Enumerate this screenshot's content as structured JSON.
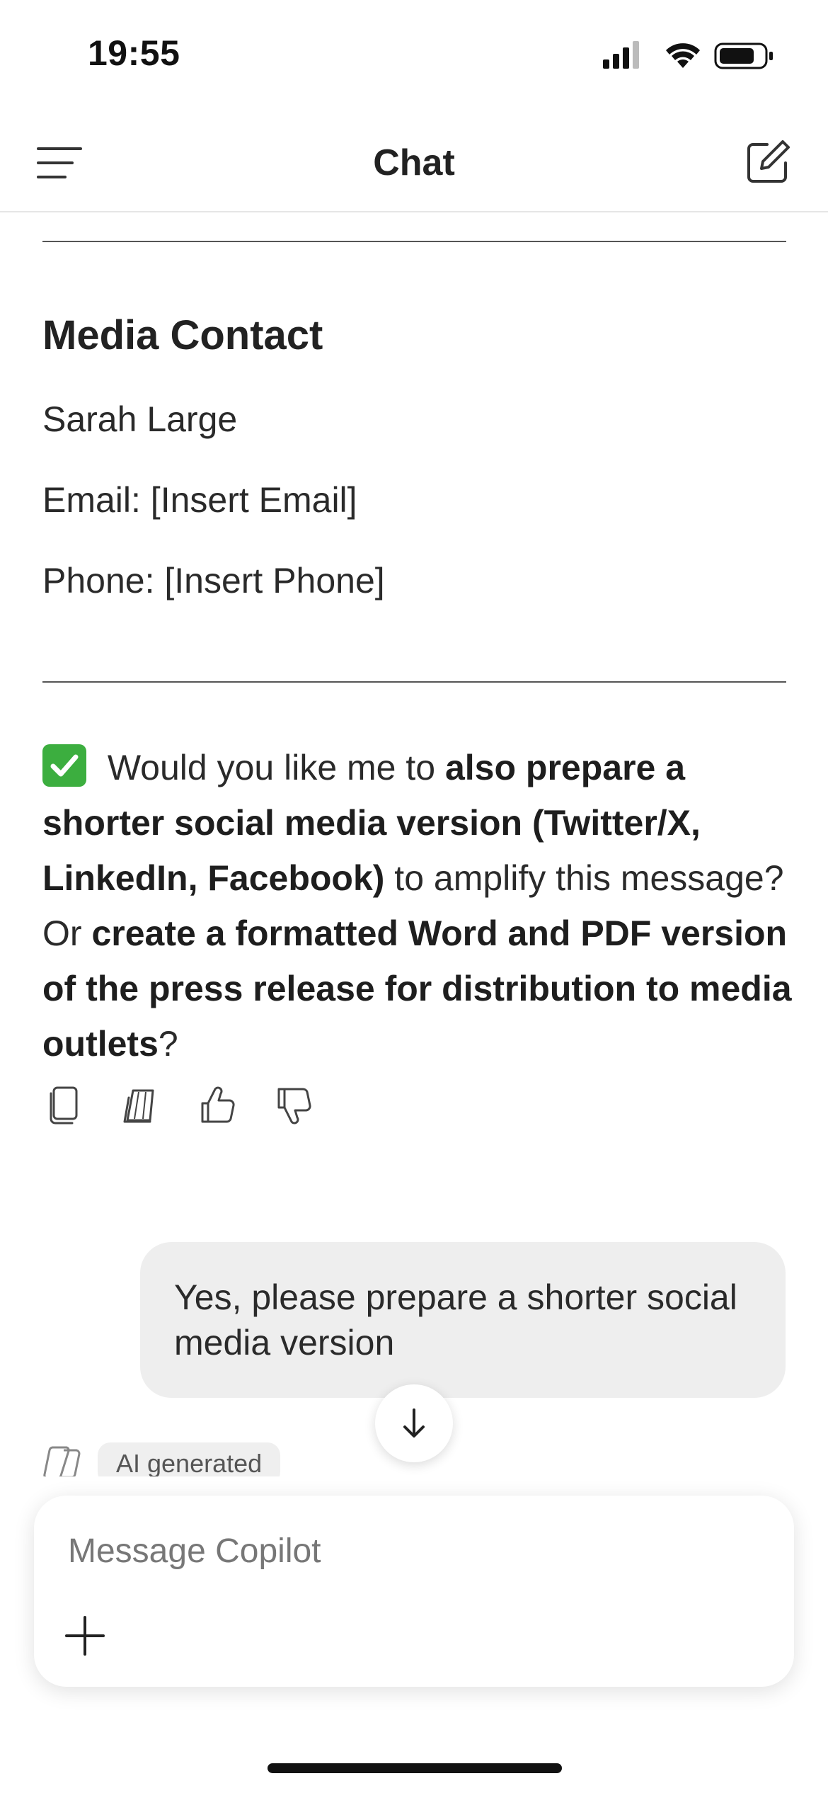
{
  "status_bar": {
    "time": "19:55",
    "icons": [
      "cellular-signal-icon",
      "wifi-icon",
      "battery-icon"
    ]
  },
  "header": {
    "title": "Chat",
    "left_icon": "menu-icon",
    "right_icon": "compose-icon"
  },
  "contact": {
    "heading": "Media Contact",
    "name": "Sarah Large",
    "email": "Email: [Insert Email]",
    "phone": "Phone: [Insert Phone]"
  },
  "assistant_message": {
    "segments": [
      {
        "text": " Would you like me to ",
        "bold": false
      },
      {
        "text": "also prepare a shorter social media version (Twitter/X, LinkedIn, Facebook)",
        "bold": true
      },
      {
        "text": " to amplify this message? Or ",
        "bold": false
      },
      {
        "text": "create a formatted Word and PDF version of the press release for distribution to media outlets",
        "bold": true
      },
      {
        "text": "?",
        "bold": false
      }
    ]
  },
  "message_actions": [
    "copy-icon",
    "pages-icon",
    "thumbs-up-icon",
    "thumbs-down-icon"
  ],
  "user_message": {
    "text": "Yes, please prepare a shorter social media version"
  },
  "ai_badge": {
    "label": "AI generated"
  },
  "composer": {
    "placeholder": "Message Copilot",
    "value": ""
  },
  "colors": {
    "check_green": "#3cae3f",
    "bubble_gray": "#eeeeee",
    "text": "#222222"
  }
}
